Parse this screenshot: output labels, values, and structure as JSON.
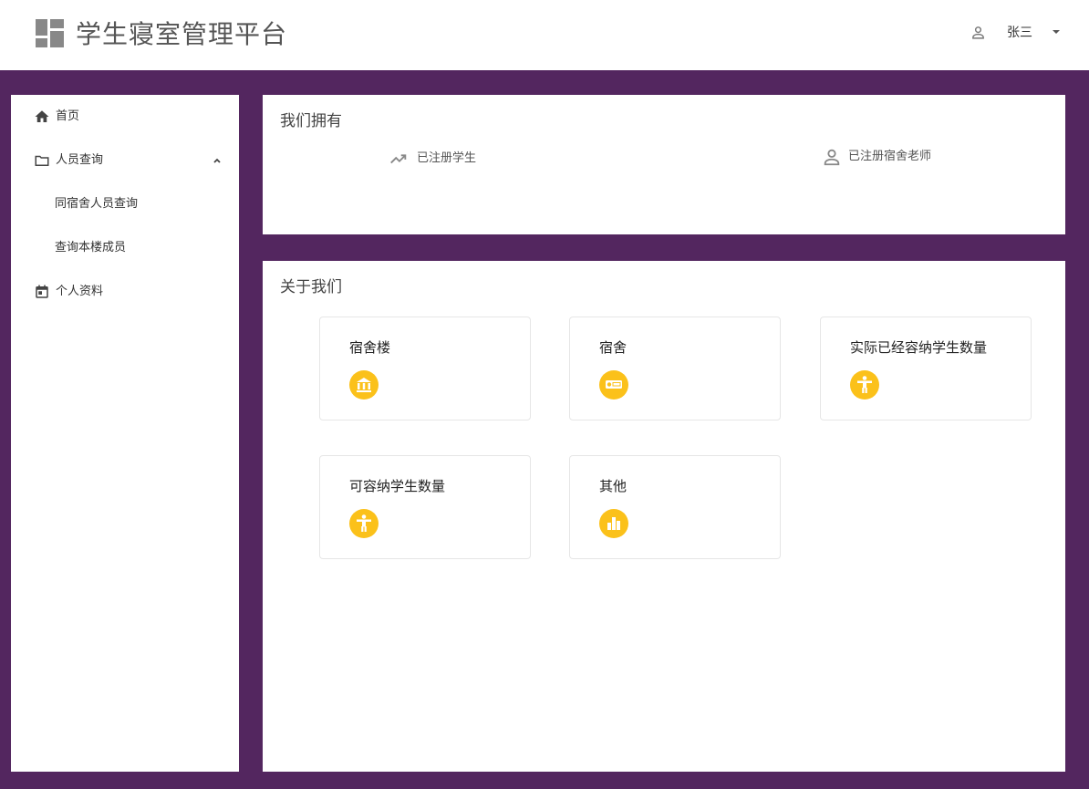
{
  "app": {
    "title": "学生寝室管理平台"
  },
  "user": {
    "name": "张三"
  },
  "sidebar": {
    "items": [
      {
        "label": "首页"
      },
      {
        "label": "人员查询"
      },
      {
        "label": "同宿舍人员查询"
      },
      {
        "label": "查询本楼成员"
      },
      {
        "label": "个人资料"
      }
    ]
  },
  "own": {
    "title": "我们拥有",
    "stats": [
      {
        "label": "已注册学生",
        "icon": "trending-up-icon"
      },
      {
        "label": "已注册宿舍老师",
        "icon": "person-icon"
      }
    ]
  },
  "about": {
    "title": "关于我们",
    "cards": [
      {
        "title": "宿舍楼",
        "icon": "bank-icon"
      },
      {
        "title": "宿舍",
        "icon": "bed-icon"
      },
      {
        "title": "实际已经容纳学生数量",
        "icon": "accessibility-icon"
      },
      {
        "title": "可容纳学生数量",
        "icon": "accessibility-icon"
      },
      {
        "title": "其他",
        "icon": "bar-chart-icon"
      }
    ]
  },
  "colors": {
    "frame": "#53265f",
    "accent": "#fbc11a"
  }
}
